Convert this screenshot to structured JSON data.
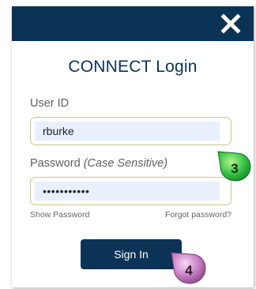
{
  "dialog": {
    "title": "CONNECT Login",
    "close_icon": "close-icon"
  },
  "user_id": {
    "label": "User ID",
    "value": "rburke"
  },
  "password": {
    "label": "Password",
    "hint": "(Case Sensitive)",
    "value": "•••••••••••"
  },
  "links": {
    "show_password": "Show Password",
    "forgot_password": "Forgot password?"
  },
  "signin_label": "Sign In",
  "callouts": [
    {
      "number": "3",
      "color": "#2db84a"
    },
    {
      "number": "4",
      "color": "#c774c4"
    }
  ],
  "colors": {
    "brand": "#0b3356",
    "field_border": "#c8c58f",
    "autofill": "#e8f0fe"
  }
}
